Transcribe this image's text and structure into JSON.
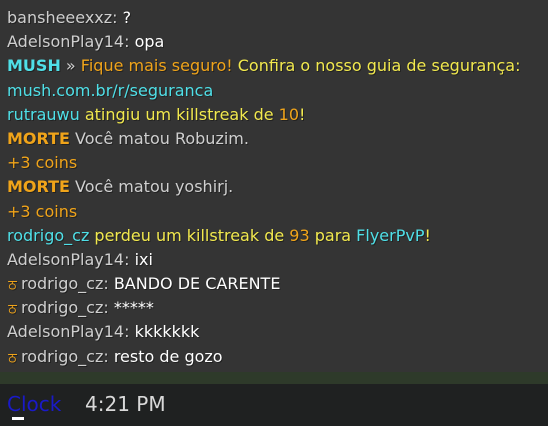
{
  "chat": {
    "lines": [
      {
        "segments": [
          {
            "text": "bansheeexxz:",
            "color": "#cfcfcf"
          },
          {
            "text": " ?",
            "color": "#ffffff"
          }
        ]
      },
      {
        "segments": [
          {
            "text": "AdelsonPlay14:",
            "color": "#cfcfcf"
          },
          {
            "text": " opa",
            "color": "#ffffff"
          }
        ]
      },
      {
        "segments": [
          {
            "text": "MUSH",
            "color": "#4fe0e8",
            "bold": true
          },
          {
            "text": " » ",
            "color": "#cfcfcf"
          },
          {
            "text": "Fique mais seguro!",
            "color": "#f0a41a"
          },
          {
            "text": " Confira o nosso guia de segurança:",
            "color": "#f2e94e"
          }
        ]
      },
      {
        "segments": [
          {
            "text": "mush.com.br/r/seguranca",
            "color": "#4fe0e8"
          }
        ]
      },
      {
        "segments": [
          {
            "text": "rutrauwu",
            "color": "#4fe0e8"
          },
          {
            "text": " atingiu um killstreak de ",
            "color": "#f2e94e"
          },
          {
            "text": "10",
            "color": "#f0a41a"
          },
          {
            "text": "!",
            "color": "#f2e94e"
          }
        ]
      },
      {
        "segments": [
          {
            "text": "MORTE",
            "color": "#f0a41a",
            "bold": true
          },
          {
            "text": " Você matou Robuzim.",
            "color": "#cfcfcf"
          }
        ]
      },
      {
        "segments": [
          {
            "text": "+3 coins",
            "color": "#f0a41a"
          }
        ]
      },
      {
        "segments": [
          {
            "text": "MORTE",
            "color": "#f0a41a",
            "bold": true
          },
          {
            "text": " Você matou yoshirj.",
            "color": "#cfcfcf"
          }
        ]
      },
      {
        "segments": [
          {
            "text": "+3 coins",
            "color": "#f0a41a"
          }
        ]
      },
      {
        "segments": [
          {
            "text": "rodrigo_cz",
            "color": "#4fe0e8"
          },
          {
            "text": " perdeu um killstreak de ",
            "color": "#f2e94e"
          },
          {
            "text": "93",
            "color": "#f0a41a"
          },
          {
            "text": " para ",
            "color": "#f2e94e"
          },
          {
            "text": "FlyerPvP",
            "color": "#4fe0e8"
          },
          {
            "text": "!",
            "color": "#f2e94e"
          }
        ]
      },
      {
        "segments": [
          {
            "text": "AdelsonPlay14:",
            "color": "#cfcfcf"
          },
          {
            "text": " ixi",
            "color": "#ffffff"
          }
        ]
      },
      {
        "badge": "ਠ",
        "segments": [
          {
            "text": "rodrigo_cz:",
            "color": "#cfcfcf"
          },
          {
            "text": " BANDO DE CARENTE",
            "color": "#ffffff"
          }
        ]
      },
      {
        "badge": "ਠ",
        "segments": [
          {
            "text": "rodrigo_cz:",
            "color": "#cfcfcf"
          },
          {
            "text": " *****",
            "color": "#ffffff"
          }
        ]
      },
      {
        "segments": [
          {
            "text": "AdelsonPlay14:",
            "color": "#cfcfcf"
          },
          {
            "text": " kkkkkkk",
            "color": "#ffffff"
          }
        ]
      },
      {
        "badge": "ਠ",
        "segments": [
          {
            "text": "rodrigo_cz:",
            "color": "#cfcfcf"
          },
          {
            "text": " resto de gozo",
            "color": "#ffffff"
          }
        ]
      }
    ]
  },
  "input_bar": {
    "clock_label": "Clock",
    "clock_time": "4:21 PM",
    "cursor": "_"
  }
}
